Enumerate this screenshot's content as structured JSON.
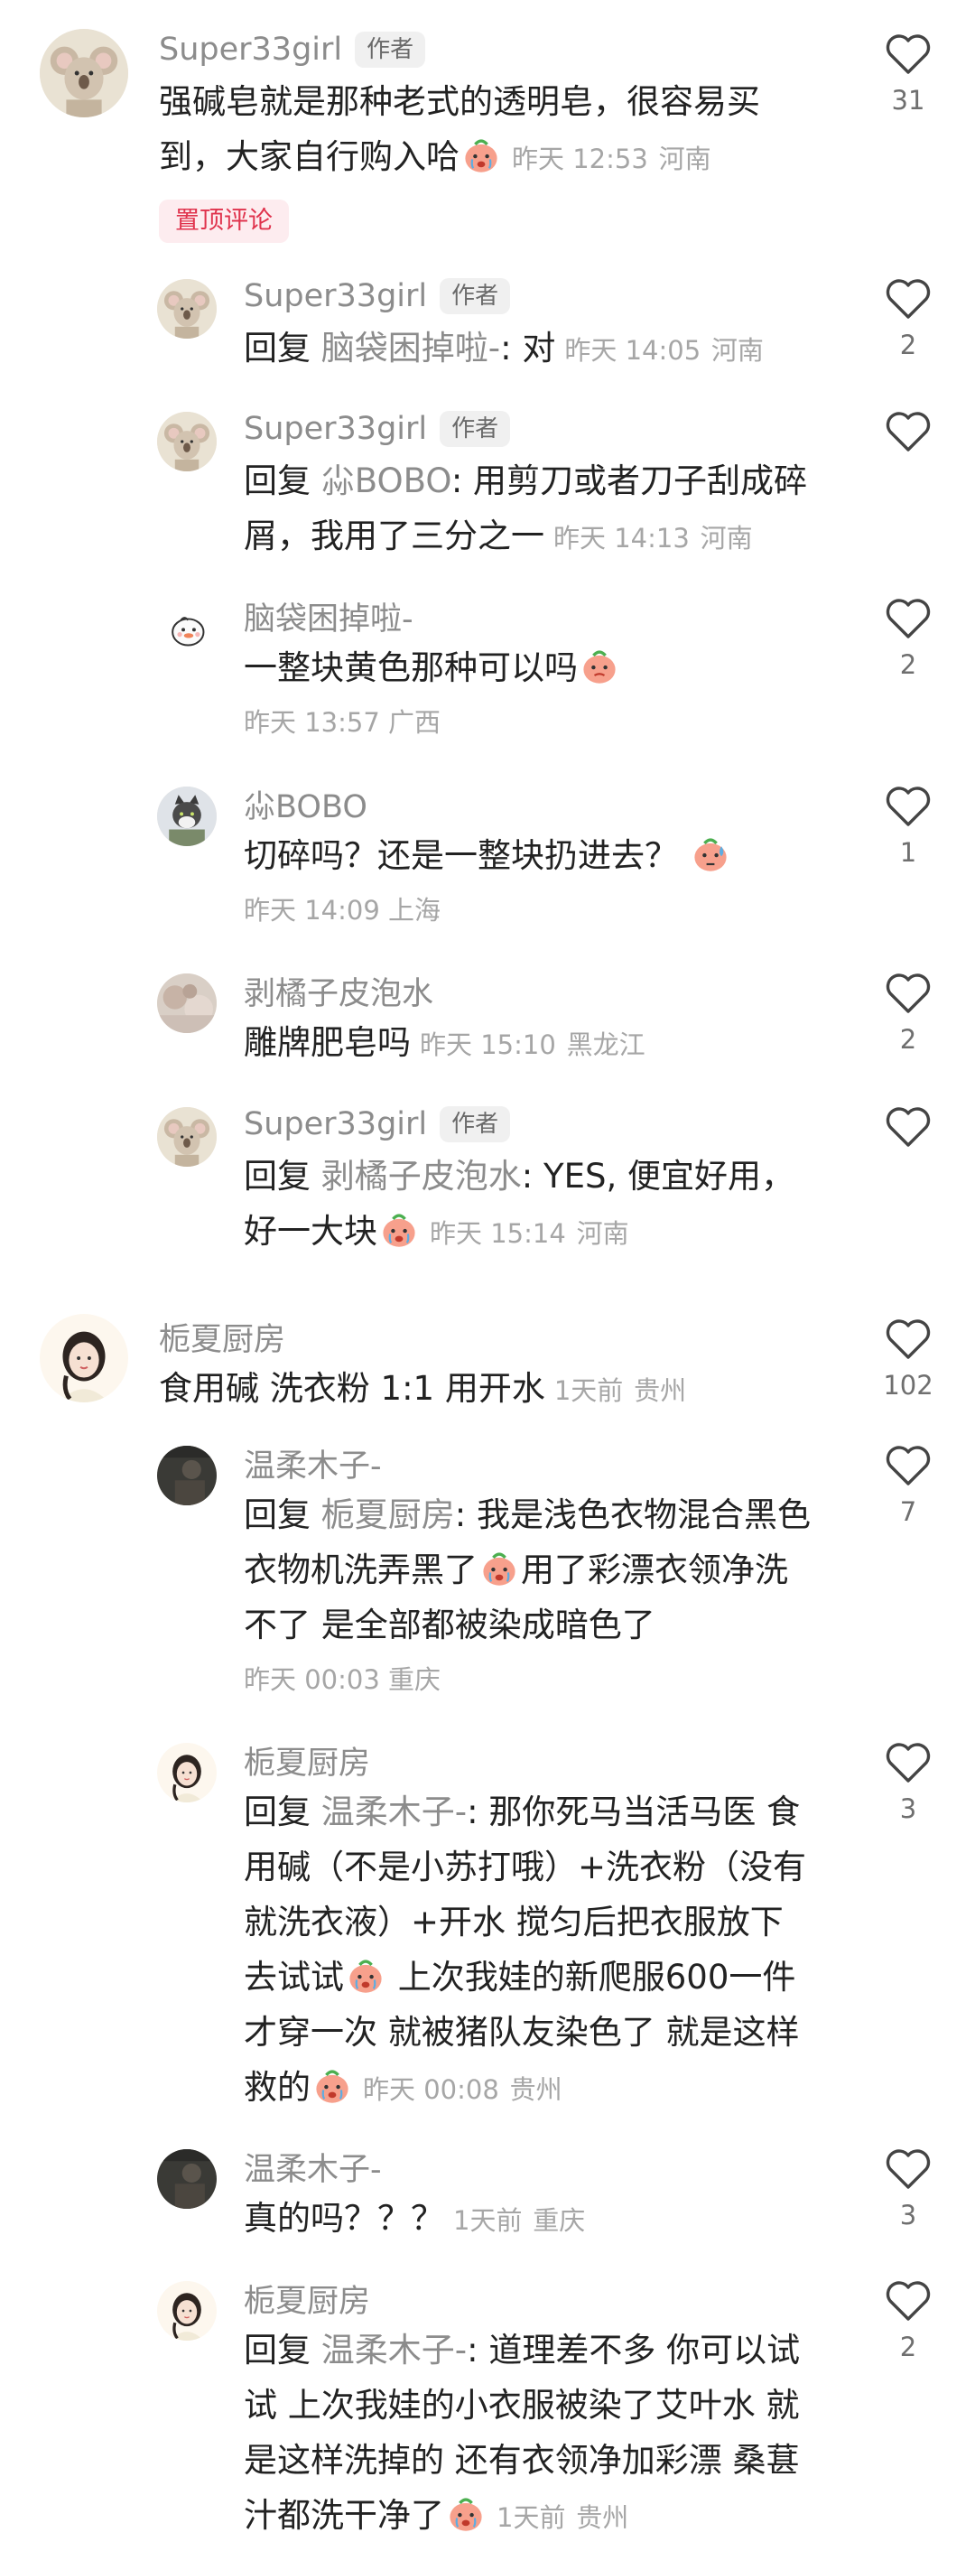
{
  "comments": [
    {
      "type": "main",
      "avatar_icon": "koala-avatar",
      "name": "Super33girl",
      "badge": "作者",
      "text_lines": [
        "强碱皂就是那种老式的透明皂，很容易买",
        "到，大家自行购入哈"
      ],
      "emoji": "crying-peach-emoji",
      "time": "昨天 12:53",
      "location": "河南",
      "pinned_label": "置顶评论",
      "likes": "31"
    },
    {
      "type": "reply",
      "avatar_icon": "koala-avatar",
      "name": "Super33girl",
      "badge": "作者",
      "reply_prefix": "回复 ",
      "reply_to": "脑袋困掉啦-",
      "text": ": 对",
      "time": "昨天 14:05",
      "location": "河南",
      "likes": "2"
    },
    {
      "type": "reply",
      "avatar_icon": "koala-avatar",
      "name": "Super33girl",
      "badge": "作者",
      "reply_prefix": "回复 ",
      "reply_to": "尛BOBO",
      "text_lines": [
        ": 用剪刀或者刀子刮成碎",
        "屑，我用了三分之一"
      ],
      "time": "昨天 14:13",
      "location": "河南",
      "likes": ""
    },
    {
      "type": "reply",
      "avatar_icon": "bird-avatar",
      "name": "脑袋困掉啦-",
      "text": "一整块黄色那种可以吗",
      "emoji": "peach-emoji",
      "time": "昨天 13:57",
      "location": "广西",
      "likes": "2"
    },
    {
      "type": "reply",
      "avatar_icon": "cat-avatar",
      "name": "尛BOBO",
      "text": "切碎吗？还是一整块扔进去？",
      "emoji": "sweat-peach-emoji",
      "time": "昨天 14:09",
      "location": "上海",
      "likes": "1"
    },
    {
      "type": "reply",
      "avatar_icon": "blur-photo-avatar",
      "name": "剥橘子皮泡水",
      "text": "雕牌肥皂吗",
      "time": "昨天 15:10",
      "location": "黑龙江",
      "likes": "2"
    },
    {
      "type": "reply",
      "avatar_icon": "koala-avatar",
      "name": "Super33girl",
      "badge": "作者",
      "reply_prefix": "回复 ",
      "reply_to": "剥橘子皮泡水",
      "text_lines": [
        ": YES, 便宜好用，",
        "好一大块"
      ],
      "emoji": "crying-peach-emoji",
      "time": "昨天 15:14",
      "location": "河南",
      "likes": ""
    },
    {
      "type": "main",
      "avatar_icon": "girl-avatar",
      "name": "栀夏厨房",
      "text": "食用碱 洗衣粉 1:1 用开水",
      "time": "1天前",
      "location": "贵州",
      "likes": "102"
    },
    {
      "type": "reply",
      "avatar_icon": "dark-photo-avatar",
      "name": "温柔木子-",
      "reply_prefix": "回复 ",
      "reply_to": "栀夏厨房",
      "text_lines": [
        ": 我是浅色衣物混合黑色",
        "衣物机洗弄黑了",
        "用了彩漂衣领净洗",
        "不了  是全部都被染成暗色了"
      ],
      "emoji": "crying-peach-emoji",
      "time": "昨天 00:03",
      "location": "重庆",
      "likes": "7"
    },
    {
      "type": "reply",
      "avatar_icon": "girl-avatar",
      "name": "栀夏厨房",
      "reply_prefix": "回复 ",
      "reply_to": "温柔木子-",
      "text_lines": [
        ": 那你死马当活马医 食",
        "用碱（不是小苏打哦）+洗衣粉（没有",
        "就洗衣液）+开水 搅匀后把衣服放下",
        "去试试",
        " 上次我娃的新爬服600一件",
        "才穿一次 就被猪队友染色了 就是这样",
        "救的"
      ],
      "emoji": "crying-peach-emoji",
      "time": "昨天 00:08",
      "location": "贵州",
      "likes": "3"
    },
    {
      "type": "reply",
      "avatar_icon": "dark-photo-avatar",
      "name": "温柔木子-",
      "text": "真的吗？？？",
      "time": "1天前",
      "location": "重庆",
      "likes": "3"
    },
    {
      "type": "reply",
      "avatar_icon": "girl-avatar",
      "name": "栀夏厨房",
      "reply_prefix": "回复 ",
      "reply_to": "温柔木子-",
      "text_lines": [
        ": 道理差不多 你可以试",
        "试 上次我娃的小衣服被染了艾叶水 就",
        "是这样洗掉的 还有衣领净加彩漂 桑葚",
        "汁都洗干净了"
      ],
      "emoji": "crying-peach-emoji",
      "time": "1天前",
      "location": "贵州",
      "likes": "2"
    }
  ]
}
